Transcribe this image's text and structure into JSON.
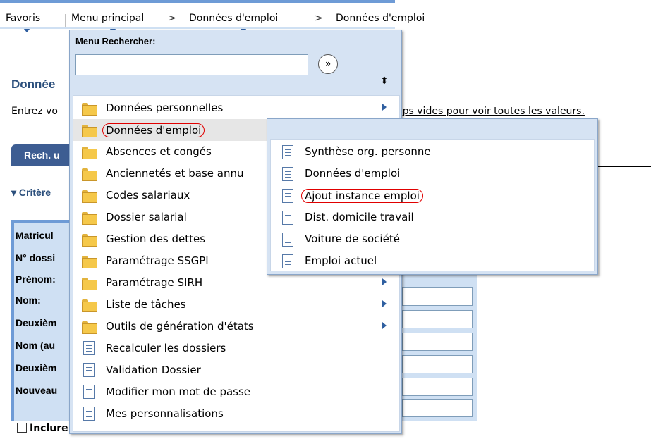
{
  "nav": {
    "favoris": "Favoris",
    "menu_principal": "Menu principal",
    "sep1": ">",
    "crumb1": "Données d'emploi",
    "sep2": ">",
    "crumb2": "Données d'emploi"
  },
  "page": {
    "title": "Donnée",
    "instruction_left": "Entrez vo",
    "instruction_right": "mps vides pour voir toutes les valeurs.",
    "tab_label": "Rech. u",
    "criteria": "▾ Critère",
    "fields": [
      "Matricul",
      "N° dossi",
      "Prénom:",
      "Nom:",
      "Deuxièm",
      "Nom (au",
      "Deuxièm",
      "Nouveau"
    ],
    "bottom_checkbox": "Inclure historique"
  },
  "menu": {
    "header": "Menu Rechercher:",
    "search_value": "",
    "go_symbol": "»",
    "sort_symbol": "⬍",
    "items": [
      {
        "label": "Données personnelles",
        "icon": "folder-icon",
        "submenu": true
      },
      {
        "label": "Données d'emploi",
        "icon": "folder-icon",
        "submenu": false,
        "highlighted": true
      },
      {
        "label": "Absences et congés",
        "icon": "folder-icon",
        "submenu": false
      },
      {
        "label": "Anciennetés et base annu",
        "icon": "folder-icon",
        "submenu": false
      },
      {
        "label": "Codes salariaux",
        "icon": "folder-icon",
        "submenu": false
      },
      {
        "label": "Dossier salarial",
        "icon": "folder-icon",
        "submenu": false
      },
      {
        "label": "Gestion des dettes",
        "icon": "folder-icon",
        "submenu": false
      },
      {
        "label": "Paramétrage SSGPI",
        "icon": "folder-icon",
        "submenu": false
      },
      {
        "label": "Paramétrage SIRH",
        "icon": "folder-icon",
        "submenu": true
      },
      {
        "label": "Liste de tâches",
        "icon": "folder-icon",
        "submenu": true
      },
      {
        "label": "Outils de génération d'états",
        "icon": "folder-icon",
        "submenu": true
      },
      {
        "label": "Recalculer les dossiers",
        "icon": "document-icon",
        "submenu": false
      },
      {
        "label": "Validation Dossier",
        "icon": "document-icon",
        "submenu": false
      },
      {
        "label": "Modifier mon mot de passe",
        "icon": "document-icon",
        "submenu": false
      },
      {
        "label": "Mes personnalisations",
        "icon": "document-icon",
        "submenu": false
      }
    ]
  },
  "submenu": {
    "items": [
      {
        "label": "Synthèse org. personne",
        "icon": "document-icon"
      },
      {
        "label": "Données d'emploi",
        "icon": "document-icon"
      },
      {
        "label": "Ajout instance emploi",
        "icon": "document-icon",
        "highlighted": true
      },
      {
        "label": "Dist. domicile travail",
        "icon": "document-icon"
      },
      {
        "label": "Voiture de société",
        "icon": "document-icon"
      },
      {
        "label": "Emploi actuel",
        "icon": "document-icon"
      }
    ]
  },
  "colors": {
    "menu_bg": "#d6e3f3",
    "accent": "#6e9bd6",
    "highlight_circle": "#e00000",
    "tab_bg": "#3d5d92"
  }
}
